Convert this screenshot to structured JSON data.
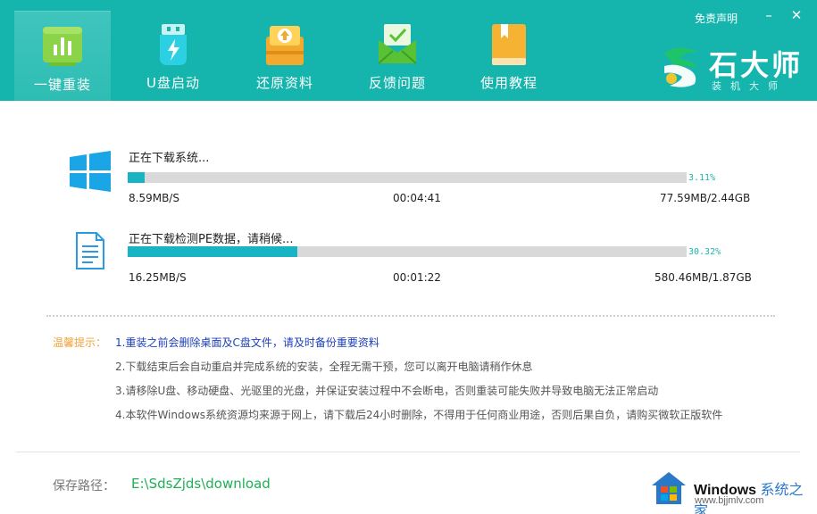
{
  "tabs": [
    {
      "label": "一键重装",
      "icon": "chart-bars-icon",
      "active": true
    },
    {
      "label": "U盘启动",
      "icon": "usb-drive-icon",
      "active": false
    },
    {
      "label": "还原资料",
      "icon": "restore-box-icon",
      "active": false
    },
    {
      "label": "反馈问题",
      "icon": "mail-feedback-icon",
      "active": false
    },
    {
      "label": "使用教程",
      "icon": "book-icon",
      "active": false
    }
  ],
  "header": {
    "disclaimer": "免责声明",
    "minimize": "–",
    "close": "✕",
    "brand_name": "石大师",
    "brand_sub": "装机大师"
  },
  "downloads": [
    {
      "title": "正在下载系统...",
      "percent_text": "3.11%",
      "progress": 0.0311,
      "speed": "8.59MB/S",
      "remaining": "00:04:41",
      "size": "77.59MB/2.44GB"
    },
    {
      "title": "正在下载检测PE数据，请稍候...",
      "percent_text": "30.32%",
      "progress": 0.3032,
      "speed": "16.25MB/S",
      "remaining": "00:01:22",
      "size": "580.46MB/1.87GB"
    }
  ],
  "tips": {
    "label": "温馨提示：",
    "items": [
      "1.重装之前会删除桌面及C盘文件，请及时备份重要资料",
      "2.下载结束后会自动重启并完成系统的安装，全程无需干预，您可以离开电脑请稍作休息",
      "3.请移除U盘、移动硬盘、光驱里的光盘，并保证安装过程中不会断电，否则重装可能失败并导致电脑无法正常启动",
      "4.本软件Windows系统资源均来源于网上，请下载后24小时删除，不得用于任何商业用途，否则后果自负，请购买微软正版软件"
    ]
  },
  "save_path": {
    "label": "保存路径：",
    "value": "E:\\SdsZjds\\download"
  },
  "watermark": {
    "text_en": "Windows",
    "text_cn": "系统之家",
    "url": "www.bjjmlv.com"
  },
  "colors": {
    "header_bg": "#15b5ad",
    "progress_fill": "#18b4c4",
    "path_green": "#1fb053",
    "tip_orange": "#f0a23a",
    "tip_blue": "#1c3fb8"
  }
}
